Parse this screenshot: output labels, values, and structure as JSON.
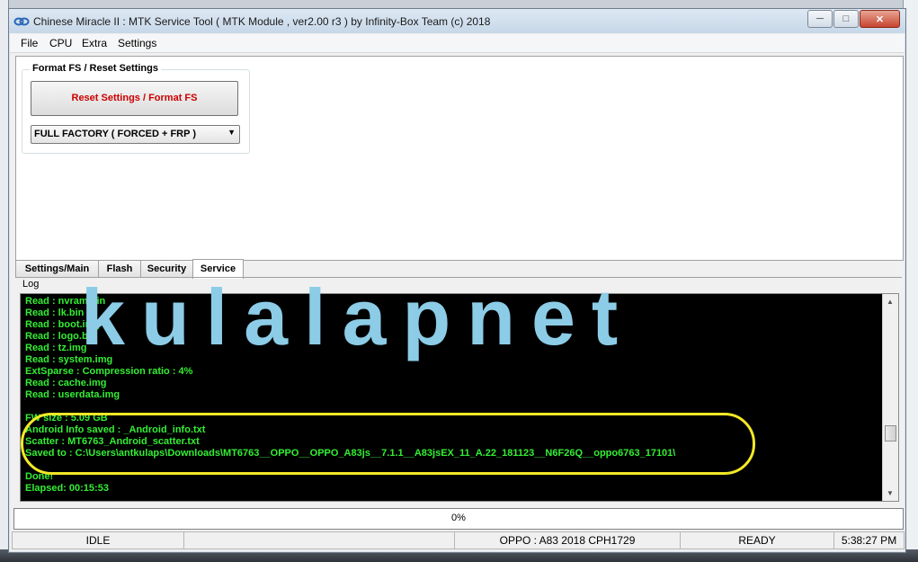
{
  "window": {
    "title": "Chinese Miracle II : MTK Service Tool ( MTK Module , ver2.00 r3  ) by Infinity-Box Team (c) 2018",
    "controls": {
      "minimize": "─",
      "maximize": "□",
      "close": "✕"
    }
  },
  "menu": [
    "File",
    "CPU",
    "Extra",
    "Settings"
  ],
  "format_group": {
    "title": "Format FS / Reset Settings",
    "button_label": "Reset Settings / Format FS",
    "dropdown_value": "FULL FACTORY ( FORCED + FRP )"
  },
  "tabs": [
    "Settings/Main",
    "Flash",
    "Security",
    "Service"
  ],
  "active_tab": "Service",
  "log": {
    "label": "Log",
    "lines": [
      "Read : nvram.bin",
      "Read : lk.bin",
      "Read : boot.img",
      "Read : logo.bin",
      "Read : tz.img",
      "Read : system.img",
      "ExtSparse : Compression ratio : 4%",
      "Read : cache.img",
      "Read : userdata.img",
      "",
      "FW size : 5.09 GB",
      "Android Info saved : _Android_info.txt",
      "Scatter : MT6763_Android_scatter.txt",
      "Saved to : C:\\Users\\antkulaps\\Downloads\\MT6763__OPPO__OPPO_A83js__7.1.1__A83jsEX_11_A.22_181123__N6F26Q__oppo6763_17101\\",
      "",
      "Done!",
      "Elapsed: 00:15:53"
    ]
  },
  "watermark": "kulalapnet",
  "progress": {
    "text": "0%",
    "value": 0
  },
  "status": {
    "state": "IDLE",
    "device": "OPPO : A83 2018 CPH1729",
    "ready": "READY",
    "time": "5:38:27 PM"
  },
  "colors": {
    "log_text": "#33ee33",
    "reset_label": "#cc0000",
    "highlight": "#f3e826",
    "watermark": "#8ccce6"
  }
}
